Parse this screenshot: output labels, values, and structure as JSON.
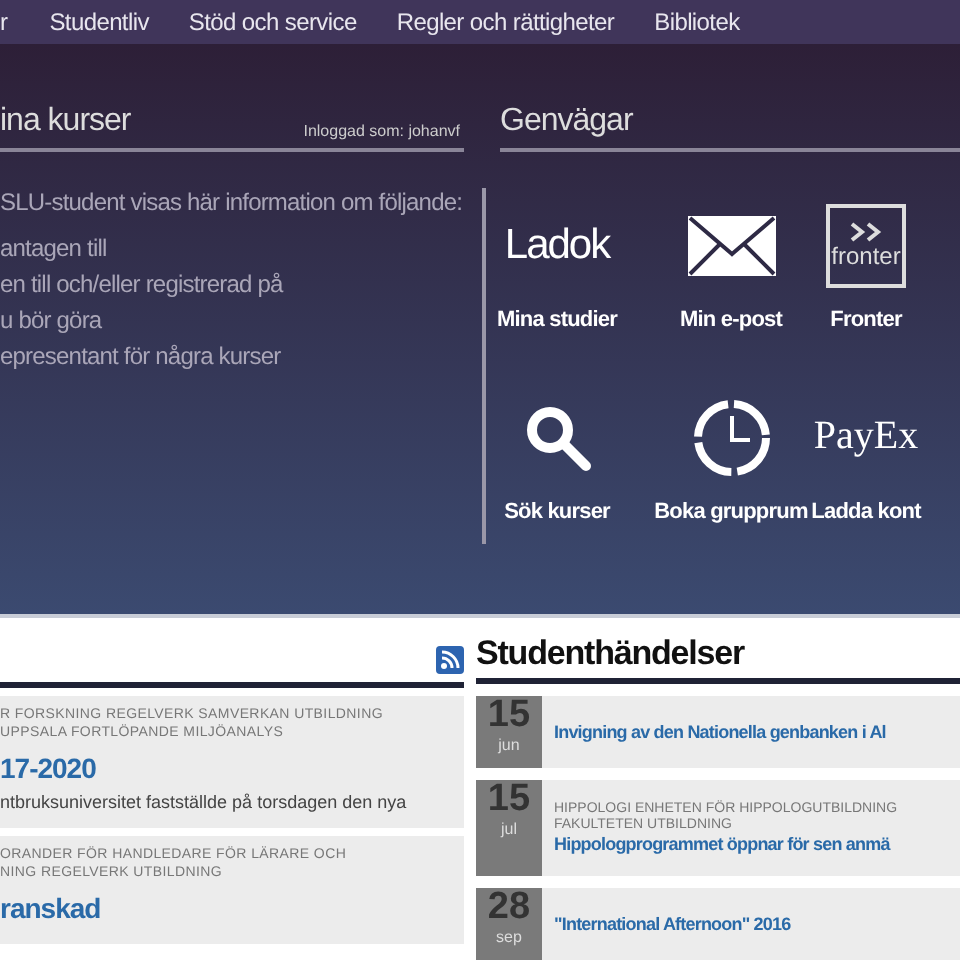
{
  "nav": {
    "items": [
      "r",
      "Studentliv",
      "Stöd och service",
      "Regler och rättigheter",
      "Bibliotek"
    ]
  },
  "courses": {
    "title": "ina kurser",
    "login": "Inloggad som: johanvf",
    "intro": "SLU-student visas här information om följande:",
    "lines": [
      "antagen till",
      "en till och/eller registrerad på",
      "u bör göra",
      "epresentant för några kurser"
    ]
  },
  "shortcuts": {
    "title": "Genvägar",
    "items": [
      {
        "kind": "ladok",
        "logo": "Ladok",
        "label": "Mina studier"
      },
      {
        "kind": "mail",
        "label": "Min e-post"
      },
      {
        "kind": "fronter",
        "logo": "fronter",
        "label": "Fronter"
      },
      {
        "kind": "search",
        "label": "Sök kurser"
      },
      {
        "kind": "clock",
        "label": "Boka grupprum"
      },
      {
        "kind": "payex",
        "logo": "PayEx",
        "label": "Ladda kont"
      }
    ]
  },
  "news": {
    "items": [
      {
        "tags": [
          "R FORSKNING REGELVERK SAMVERKAN UTBILDNING",
          "UPPSALA FORTLÖPANDE MILJÖANALYS"
        ],
        "title": "17-2020",
        "text": "ntbruksuniversitet fastställde på torsdagen den nya"
      },
      {
        "tags": [
          "ORANDER FÖR HANDLEDARE FÖR LÄRARE OCH",
          "NING REGELVERK UTBILDNING"
        ],
        "title": "ranskad"
      }
    ]
  },
  "events": {
    "title": "Studenthändelser",
    "items": [
      {
        "day": "15",
        "month": "jun",
        "title": "Invigning av den Nationella genbanken i Al"
      },
      {
        "day": "15",
        "month": "jul",
        "tags": [
          "HIPPOLOGI ENHETEN FÖR HIPPOLOGUTBILDNING",
          "FAKULTETEN UTBILDNING"
        ],
        "title": "Hippologprogrammet öppnar för sen anmä"
      },
      {
        "day": "28",
        "month": "sep",
        "title": "\"International Afternoon\" 2016"
      }
    ]
  }
}
